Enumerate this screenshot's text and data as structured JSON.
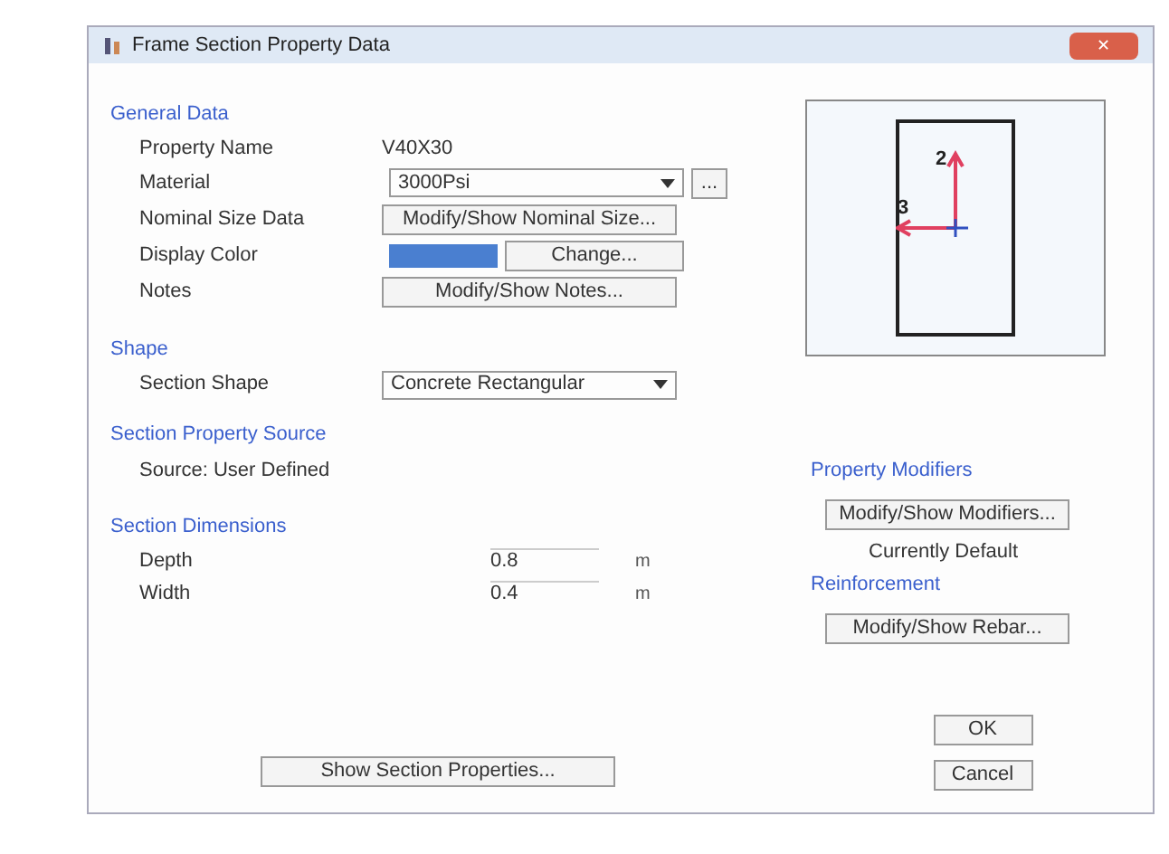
{
  "window": {
    "title": "Frame Section Property Data",
    "close": "✕"
  },
  "general_data": {
    "heading": "General Data",
    "property_name": {
      "label": "Property Name",
      "value": "V40X30"
    },
    "material": {
      "label": "Material",
      "value": "3000Psi",
      "more": "..."
    },
    "nominal_size": {
      "label": "Nominal Size Data",
      "button": "Modify/Show Nominal Size..."
    },
    "display_color": {
      "label": "Display Color",
      "color": "#4a7fd0",
      "button": "Change..."
    },
    "notes": {
      "label": "Notes",
      "button": "Modify/Show Notes..."
    }
  },
  "shape": {
    "heading": "Shape",
    "label": "Section Shape",
    "value": "Concrete Rectangular"
  },
  "property_source": {
    "heading": "Section Property Source",
    "text": "Source:  User Defined"
  },
  "dimensions": {
    "heading": "Section Dimensions",
    "rows": [
      {
        "label": "Depth",
        "value": "0.8",
        "unit": "m"
      },
      {
        "label": "Width",
        "value": "0.4",
        "unit": "m"
      }
    ]
  },
  "preview": {
    "axis_vertical": "2",
    "axis_horizontal": "3"
  },
  "property_modifiers": {
    "heading": "Property Modifiers",
    "button": "Modify/Show Modifiers...",
    "status": "Currently Default"
  },
  "reinforcement": {
    "heading": "Reinforcement",
    "button": "Modify/Show Rebar..."
  },
  "buttons": {
    "show_properties": "Show Section Properties...",
    "ok": "OK",
    "cancel": "Cancel"
  }
}
